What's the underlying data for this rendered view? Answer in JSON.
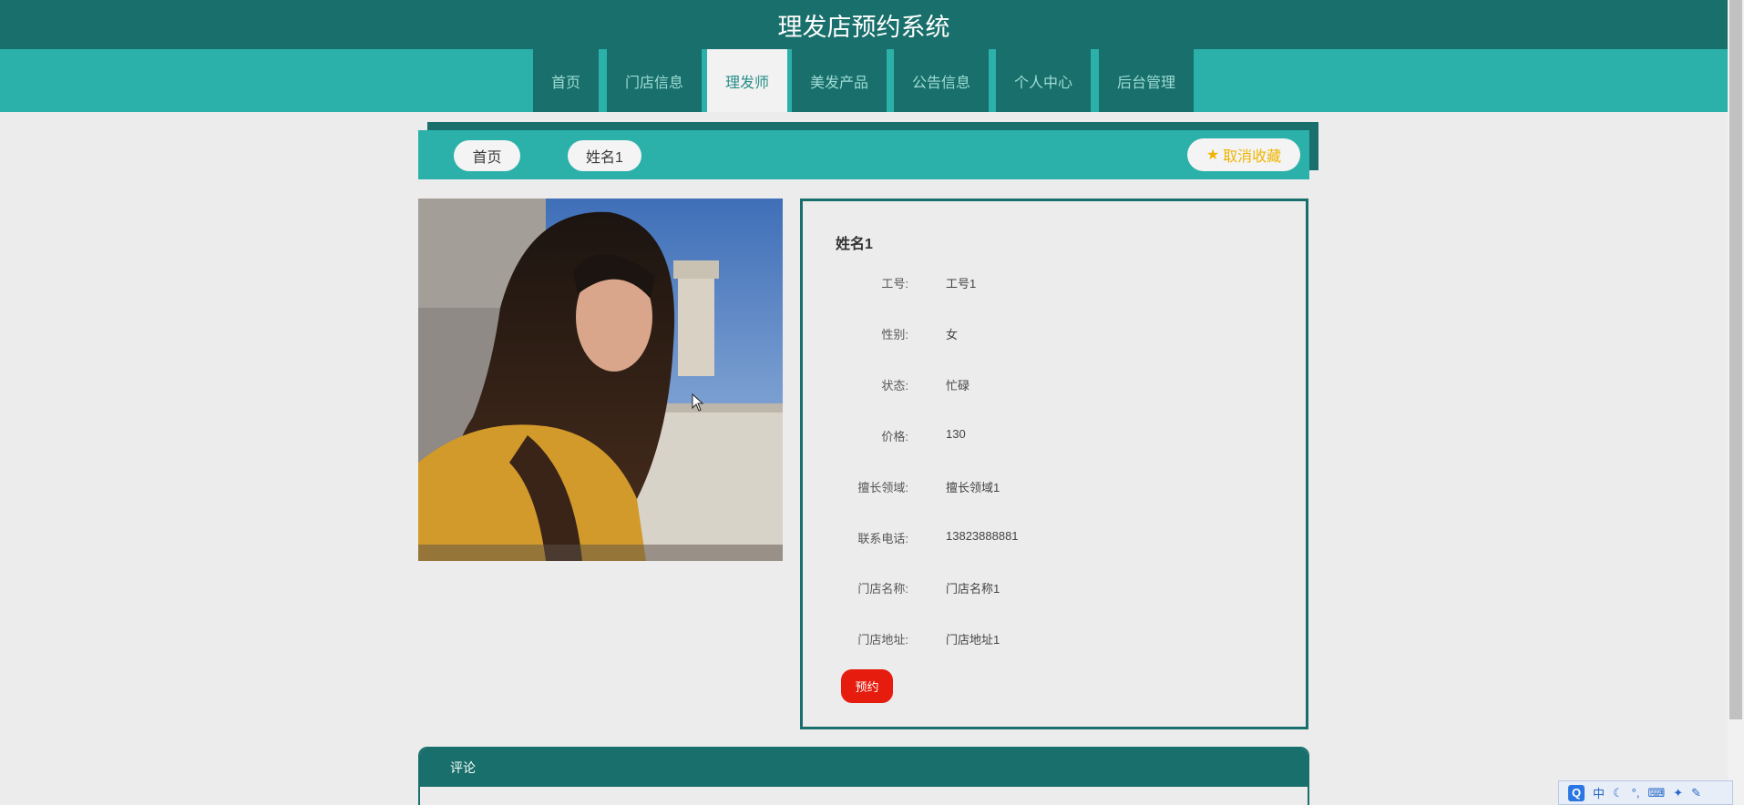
{
  "header": {
    "title": "理发店预约系统"
  },
  "nav": {
    "items": [
      {
        "label": "首页",
        "active": false
      },
      {
        "label": "门店信息",
        "active": false
      },
      {
        "label": "理发师",
        "active": true
      },
      {
        "label": "美发产品",
        "active": false
      },
      {
        "label": "公告信息",
        "active": false
      },
      {
        "label": "个人中心",
        "active": false
      },
      {
        "label": "后台管理",
        "active": false
      }
    ]
  },
  "breadcrumb": {
    "home": "首页",
    "current": "姓名1",
    "favorite_label": "取消收藏",
    "favorite_icon": "star-icon"
  },
  "detail": {
    "name": "姓名1",
    "fields": [
      {
        "label": "工号:",
        "value": "工号1"
      },
      {
        "label": "性别:",
        "value": "女"
      },
      {
        "label": "状态:",
        "value": "忙碌"
      },
      {
        "label": "价格:",
        "value": "130"
      },
      {
        "label": "擅长领域:",
        "value": "擅长领域1"
      },
      {
        "label": "联系电话:",
        "value": "13823888881"
      },
      {
        "label": "门店名称:",
        "value": "门店名称1"
      },
      {
        "label": "门店地址:",
        "value": "门店地址1"
      }
    ],
    "book_label": "预约"
  },
  "comments": {
    "title": "评论"
  },
  "ime": {
    "mode": "中"
  },
  "colors": {
    "primary_dark": "#186f6b",
    "primary": "#2bb1aa",
    "danger": "#e51c0e",
    "star": "#f0b400"
  }
}
